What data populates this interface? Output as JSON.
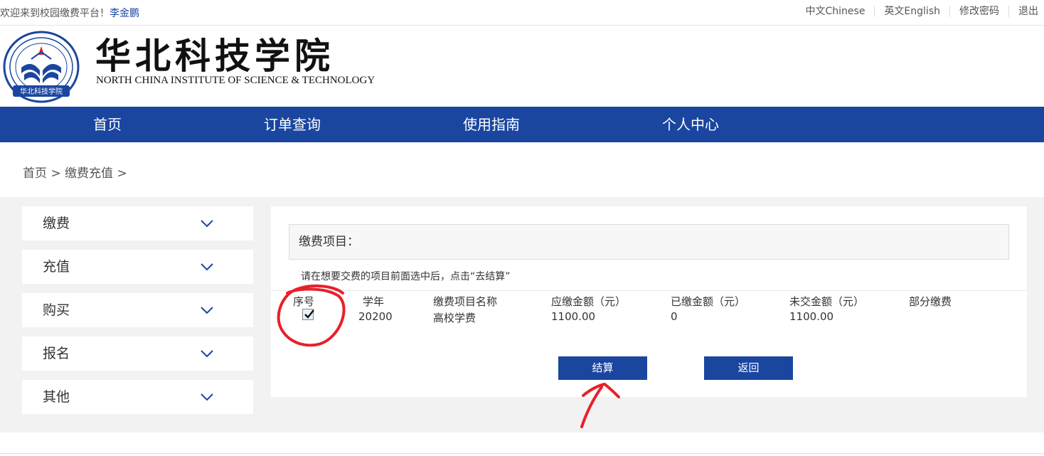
{
  "topbar": {
    "welcome": "欢迎来到校园缴费平台！",
    "user": "李金鹏",
    "links": [
      "中文Chinese",
      "英文English",
      "修改密码",
      "退出"
    ]
  },
  "header": {
    "school_cn": "华北科技学院",
    "school_en": "NORTH CHINA INSTITUTE OF SCIENCE & TECHNOLOGY",
    "seal_text": "华北科技学院"
  },
  "nav": [
    "首页",
    "订单查询",
    "使用指南",
    "个人中心"
  ],
  "breadcrumb": "首页 > 缴费充值 >",
  "sidebar": [
    {
      "label": "缴费",
      "icon": "chevron-down-icon"
    },
    {
      "label": "充值",
      "icon": "chevron-down-icon"
    },
    {
      "label": "购买",
      "icon": "chevron-down-icon"
    },
    {
      "label": "报名",
      "icon": "chevron-down-icon"
    },
    {
      "label": "其他",
      "icon": "chevron-down-icon"
    }
  ],
  "main": {
    "project_title": "缴费项目：",
    "hint": "请在想要交费的项目前面选中后，点击“去结算”",
    "columns": [
      "序号",
      "学年",
      "缴费项目名称",
      "应缴金额（元）",
      "已缴金额（元）",
      "未交金额（元）",
      "部分缴费"
    ],
    "rows": [
      {
        "checked": true,
        "year": "20200",
        "name": "高校学费",
        "due": "1100.00",
        "paid": "0",
        "unpaid": "1100.00",
        "partial": ""
      }
    ],
    "checkout_label": "结算",
    "back_label": "返回"
  },
  "colors": {
    "brand_blue": "#1a46a0",
    "annotation_red": "#e8202a"
  }
}
